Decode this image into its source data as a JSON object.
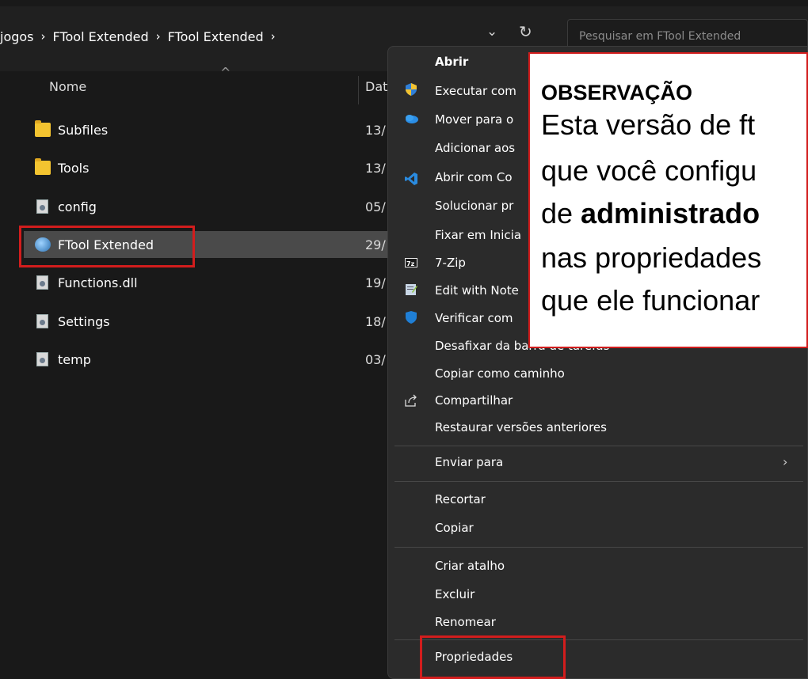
{
  "breadcrumb": {
    "items": [
      "jogos",
      "FTool Extended",
      "FTool Extended"
    ],
    "sep": "›",
    "trailing": "›"
  },
  "toolbar": {
    "dropdown_glyph": "⌄",
    "refresh_glyph": "↻"
  },
  "search": {
    "placeholder": "Pesquisar em FTool Extended"
  },
  "columns": {
    "name": "Nome",
    "date": "Dat",
    "sort_glyph": "^"
  },
  "files": [
    {
      "name": "Subfiles",
      "date": "13/",
      "icon": "folder-icon"
    },
    {
      "name": "Tools",
      "date": "13/",
      "icon": "folder-icon"
    },
    {
      "name": "config",
      "date": "05/",
      "icon": "settings-file-icon"
    },
    {
      "name": "FTool Extended",
      "date": "29/",
      "icon": "app-icon",
      "selected": true
    },
    {
      "name": "Functions.dll",
      "date": "19/",
      "icon": "dll-file-icon"
    },
    {
      "name": "Settings",
      "date": "18/",
      "icon": "settings-file-icon"
    },
    {
      "name": "temp",
      "date": "03/",
      "icon": "settings-file-icon"
    }
  ],
  "context_menu": {
    "items": [
      {
        "label": "Abrir",
        "bold": true
      },
      {
        "label": "Executar com",
        "icon": "shield-icon"
      },
      {
        "label": "Mover para o",
        "icon": "onedrive-icon"
      },
      {
        "label": "Adicionar aos"
      },
      {
        "label": "Abrir com Co",
        "icon": "vscode-icon"
      },
      {
        "label": "Solucionar pr"
      },
      {
        "label": "Fixar em Inicia"
      },
      {
        "label": "7-Zip",
        "icon": "7zip-icon"
      },
      {
        "label": "Edit with Note",
        "icon": "notepad-icon"
      },
      {
        "label": "Verificar com",
        "icon": "defender-icon"
      },
      {
        "label": "Desafixar da barra de tarefas"
      },
      {
        "label": "Copiar como caminho"
      },
      {
        "label": "Compartilhar",
        "icon": "share-icon"
      },
      {
        "label": "Restaurar versões anteriores"
      },
      {
        "label": "Enviar para",
        "submenu": "›"
      },
      {
        "label": "Recortar"
      },
      {
        "label": "Copiar"
      },
      {
        "label": "Criar atalho"
      },
      {
        "label": "Excluir"
      },
      {
        "label": "Renomear"
      },
      {
        "label": "Propriedades"
      }
    ]
  },
  "observation": {
    "title": "OBSERVAÇÃO",
    "lines": [
      {
        "text": "Esta versão de ft"
      },
      {
        "text": "que você configu"
      },
      {
        "pre": "de ",
        "bold": "administrado"
      },
      {
        "text": "nas propriedades"
      },
      {
        "text": "que ele funcionar"
      }
    ]
  },
  "colors": {
    "background": "#191919",
    "menu_bg": "#2b2b2b",
    "selection": "#4a4a4a",
    "highlight_box": "#d21d1d",
    "folder": "#f4c430"
  }
}
